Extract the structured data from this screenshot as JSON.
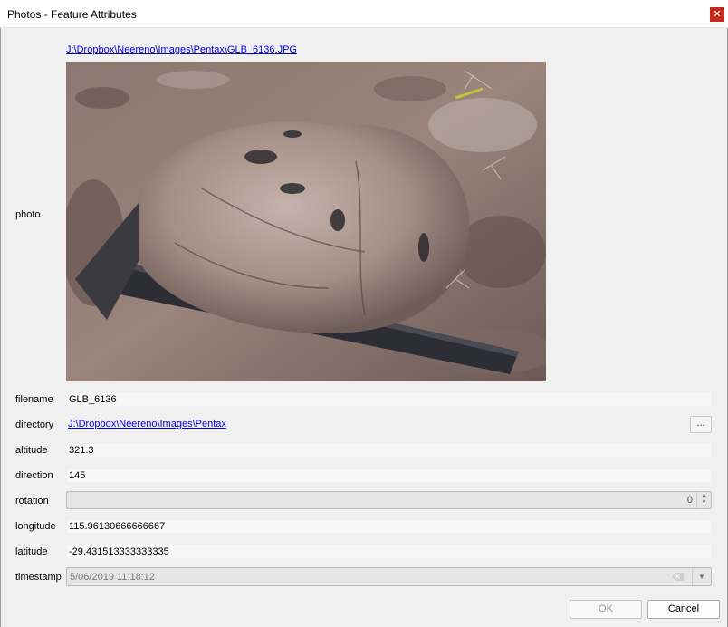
{
  "window": {
    "title": "Photos - Feature Attributes",
    "close_glyph": "✕"
  },
  "photo": {
    "label": "photo",
    "path_link": "J:\\Dropbox\\Neereno\\Images\\Pentax\\GLB_6136.JPG",
    "image_description_icon": "rock-photo-image"
  },
  "fields": {
    "filename": {
      "label": "filename",
      "value": "GLB_6136"
    },
    "directory": {
      "label": "directory",
      "value": "J:\\Dropbox\\Neereno\\Images\\Pentax",
      "button": "..."
    },
    "altitude": {
      "label": "altitude",
      "value": "321.3"
    },
    "direction": {
      "label": "direction",
      "value": "145"
    },
    "rotation": {
      "label": "rotation",
      "value": "0"
    },
    "longitude": {
      "label": "longitude",
      "value": "115.96130666666667"
    },
    "latitude": {
      "label": "latitude",
      "value": "-29.431513333333335"
    },
    "timestamp": {
      "label": "timestamp",
      "value": "5/06/2019 11:18:12"
    }
  },
  "buttons": {
    "ok": "OK",
    "cancel": "Cancel"
  },
  "colors": {
    "link": "#0000ee",
    "close_bg": "#c42b1c",
    "dialog_bg": "#f0f0f0"
  }
}
